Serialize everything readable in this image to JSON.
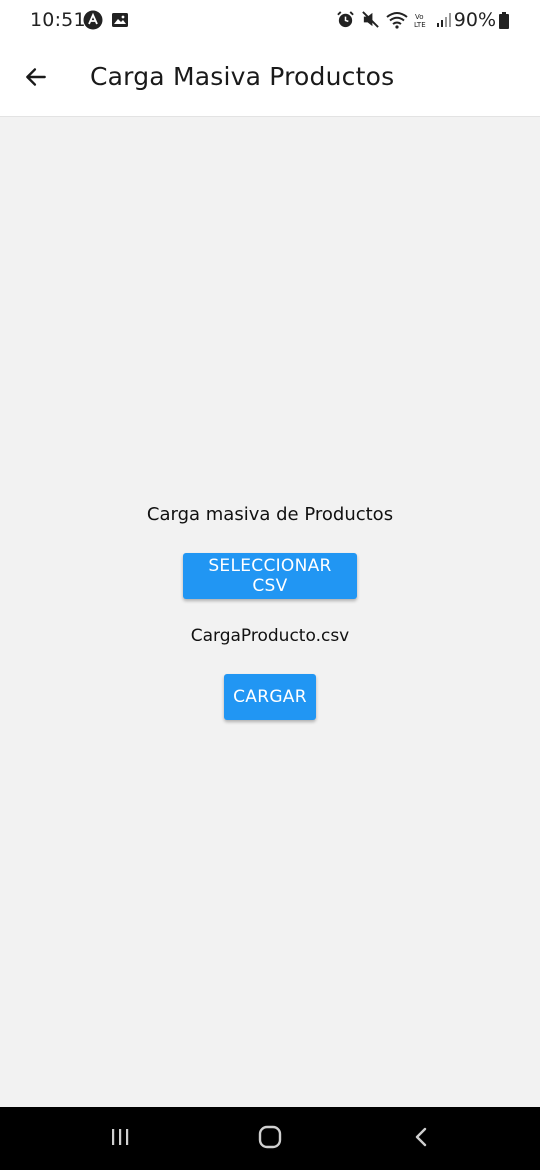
{
  "status_bar": {
    "time": "10:51",
    "battery": "90%",
    "icons": [
      "android-auto-icon",
      "image-icon",
      "alarm-icon",
      "mute-icon",
      "wifi-icon",
      "volte-icon",
      "signal-icon",
      "battery-icon"
    ]
  },
  "app_bar": {
    "title": "Carga Masiva Productos",
    "back_icon": "arrow-left-icon"
  },
  "main": {
    "section_title": "Carga masiva de Productos",
    "select_button_label": "SELECCIONAR CSV",
    "selected_file": "CargaProducto.csv",
    "upload_button_label": "CARGAR"
  },
  "nav_bar": {
    "icons": [
      "recents-icon",
      "home-icon",
      "back-icon"
    ]
  },
  "colors": {
    "accent": "#2196f3",
    "background": "#f2f2f2",
    "app_bar": "#ffffff",
    "nav_bar": "#000000"
  }
}
